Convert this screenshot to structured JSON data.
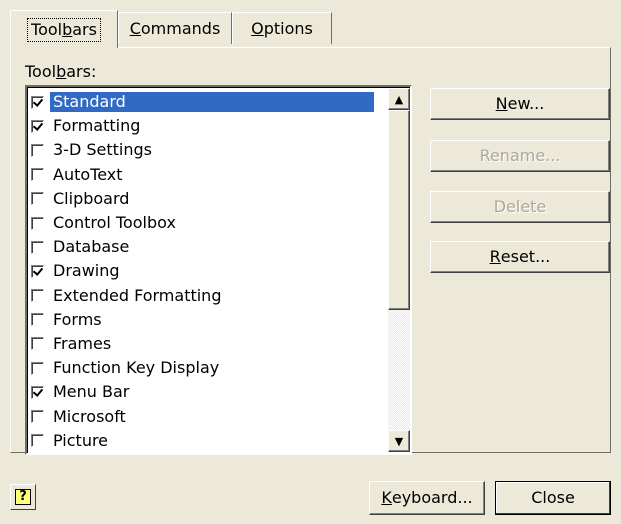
{
  "tabs": [
    {
      "label_pre": "Tool",
      "label_ul": "b",
      "label_post": "ars",
      "active": true
    },
    {
      "label_pre": "",
      "label_ul": "C",
      "label_post": "ommands",
      "active": false
    },
    {
      "label_pre": "",
      "label_ul": "O",
      "label_post": "ptions",
      "active": false
    }
  ],
  "list_label": {
    "pre": "Tool",
    "ul": "b",
    "post": "ars:"
  },
  "toolbars": [
    {
      "label": "Standard",
      "checked": true,
      "selected": true
    },
    {
      "label": "Formatting",
      "checked": true,
      "selected": false
    },
    {
      "label": "3-D Settings",
      "checked": false,
      "selected": false
    },
    {
      "label": "AutoText",
      "checked": false,
      "selected": false
    },
    {
      "label": "Clipboard",
      "checked": false,
      "selected": false
    },
    {
      "label": "Control Toolbox",
      "checked": false,
      "selected": false
    },
    {
      "label": "Database",
      "checked": false,
      "selected": false
    },
    {
      "label": "Drawing",
      "checked": true,
      "selected": false
    },
    {
      "label": "Extended Formatting",
      "checked": false,
      "selected": false
    },
    {
      "label": "Forms",
      "checked": false,
      "selected": false
    },
    {
      "label": "Frames",
      "checked": false,
      "selected": false
    },
    {
      "label": "Function Key Display",
      "checked": false,
      "selected": false
    },
    {
      "label": "Menu Bar",
      "checked": true,
      "selected": false
    },
    {
      "label": "Microsoft",
      "checked": false,
      "selected": false
    },
    {
      "label": "Picture",
      "checked": false,
      "selected": false
    }
  ],
  "buttons": {
    "new": {
      "ul": "N",
      "post": "ew..."
    },
    "rename": {
      "label": "Rename..."
    },
    "delete": {
      "label": "Delete"
    },
    "reset": {
      "ul": "R",
      "post": "eset..."
    },
    "keyboard": {
      "ul": "K",
      "post": "eyboard..."
    },
    "close": {
      "label": "Close"
    }
  },
  "help_icon": {
    "glyph": "?"
  },
  "scroll": {
    "up_glyph": "▲",
    "down_glyph": "▼"
  }
}
